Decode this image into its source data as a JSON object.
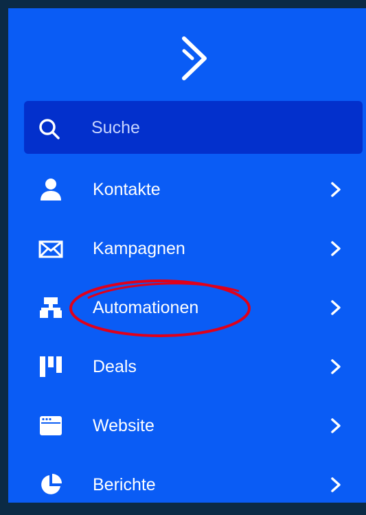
{
  "search": {
    "placeholder": "Suche",
    "icon": "search-icon"
  },
  "brand": {
    "icon": "activecampaign-logo-icon"
  },
  "colors": {
    "sidebar": "#0a5cf5",
    "search_bg": "#0330cc",
    "frame": "#0b2a45",
    "annotation": "#e0001a"
  },
  "nav": {
    "items": [
      {
        "label": "Kontakte",
        "icon": "person-icon"
      },
      {
        "label": "Kampagnen",
        "icon": "envelope-icon"
      },
      {
        "label": "Automationen",
        "icon": "workflow-icon"
      },
      {
        "label": "Deals",
        "icon": "pipeline-icon"
      },
      {
        "label": "Website",
        "icon": "browser-window-icon"
      },
      {
        "label": "Berichte",
        "icon": "pie-chart-icon"
      }
    ]
  }
}
